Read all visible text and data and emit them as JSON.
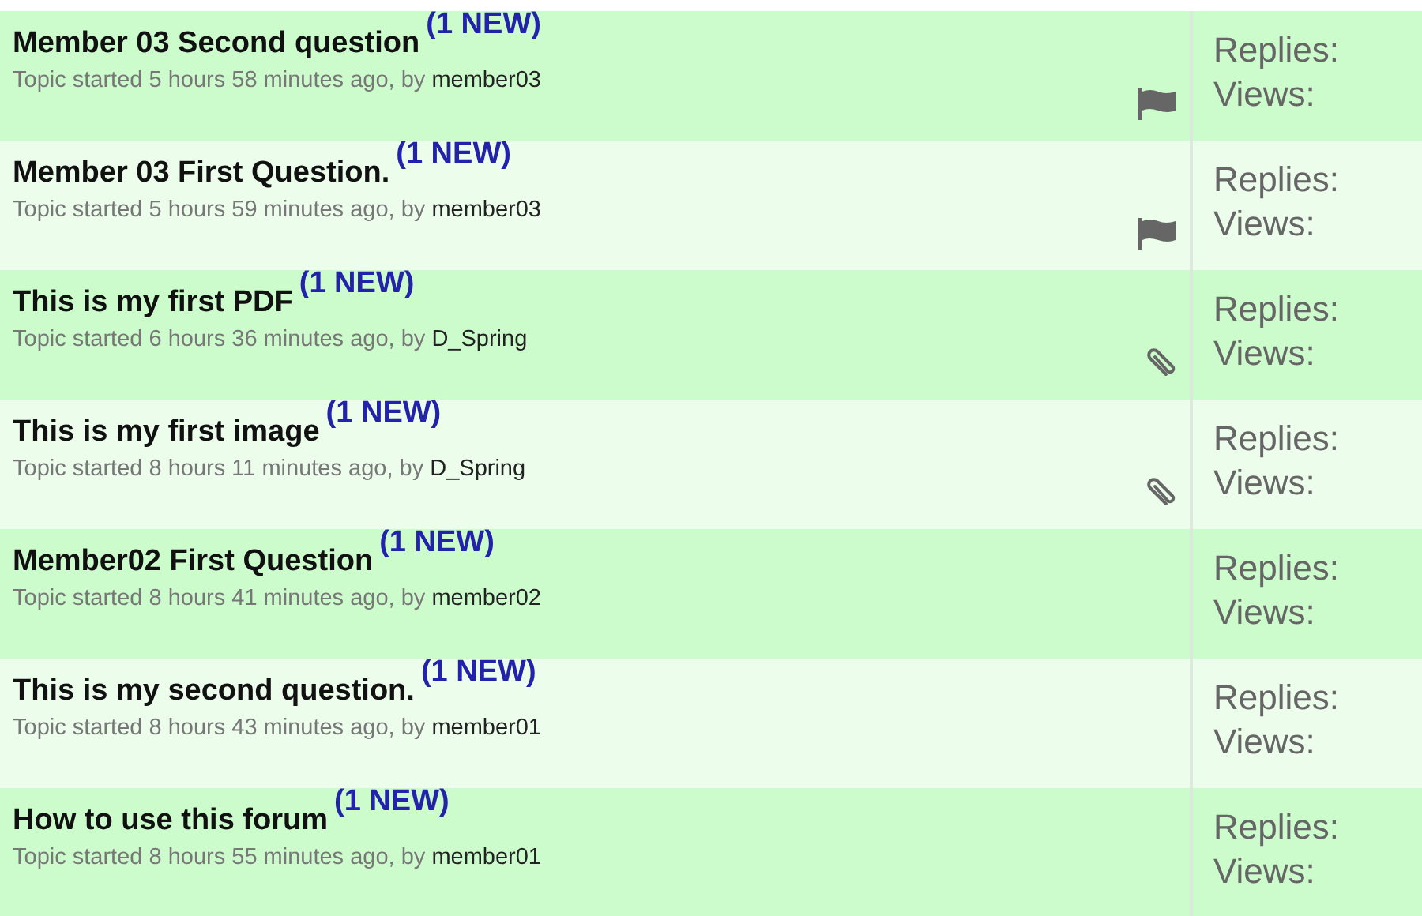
{
  "topics": [
    {
      "title": "Member 03 Second question",
      "badge": "(1 NEW)",
      "meta": "Topic started 5 hours 58 minutes ago, by",
      "author": "member03",
      "kind": "flagged",
      "replies": "Replies:",
      "views": "Views:"
    },
    {
      "title": "Member 03 First Question.",
      "badge": "(1 NEW)",
      "meta": "Topic started 5 hours 59 minutes ago, by",
      "author": "member03",
      "kind": "flagged",
      "replies": "Replies:",
      "views": "Views:"
    },
    {
      "title": "This is my first PDF",
      "badge": "(1 NEW)",
      "meta": "Topic started 6 hours 36 minutes ago, by",
      "author": "D_Spring",
      "kind": "attachment",
      "replies": "Replies:",
      "views": "Views:"
    },
    {
      "title": "This is my first image",
      "badge": "(1 NEW)",
      "meta": "Topic started 8 hours 11 minutes ago, by",
      "author": "D_Spring",
      "kind": "attachment",
      "replies": "Replies:",
      "views": "Views:"
    },
    {
      "title": "Member02 First Question",
      "badge": "(1 NEW)",
      "meta": "Topic started 8 hours 41 minutes ago, by",
      "author": "member02",
      "kind": "plain",
      "replies": "Replies:",
      "views": "Views:"
    },
    {
      "title": "This is my second question.",
      "badge": "(1 NEW)",
      "meta": "Topic started 8 hours 43 minutes ago, by",
      "author": "member01",
      "kind": "plain",
      "replies": "Replies:",
      "views": "Views:"
    },
    {
      "title": "How to use this forum",
      "badge": "(1 NEW)",
      "meta": "Topic started 8 hours 55 minutes ago, by",
      "author": "member01",
      "kind": "plain",
      "replies": "Replies:",
      "views": "Views:"
    }
  ]
}
